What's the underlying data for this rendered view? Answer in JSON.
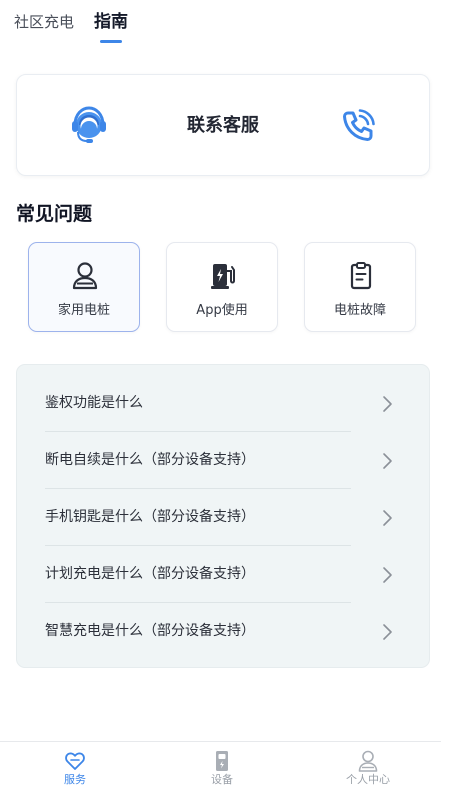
{
  "top_tabs": [
    {
      "label": "社区充电",
      "active": false
    },
    {
      "label": "指南",
      "active": true
    }
  ],
  "service": {
    "title": "联系客服",
    "left_icon": "headset-agent-icon",
    "right_icon": "phone-call-icon"
  },
  "faq": {
    "heading": "常见问题",
    "categories": [
      {
        "label": "家用电桩",
        "icon": "user-icon",
        "selected": true
      },
      {
        "label": "App使用",
        "icon": "charging-pile-icon",
        "selected": false
      },
      {
        "label": "电桩故障",
        "icon": "clipboard-icon",
        "selected": false
      }
    ],
    "items": [
      {
        "label": "鉴权功能是什么"
      },
      {
        "label": "断电自续是什么（部分设备支持）"
      },
      {
        "label": "手机钥匙是什么（部分设备支持）"
      },
      {
        "label": "计划充电是什么（部分设备支持）"
      },
      {
        "label": "智慧充电是什么（部分设备支持）"
      }
    ]
  },
  "bottom_nav": [
    {
      "label": "服务",
      "icon": "heart-icon",
      "active": true
    },
    {
      "label": "设备",
      "icon": "device-icon",
      "active": false
    },
    {
      "label": "个人中心",
      "icon": "person-icon",
      "active": false
    }
  ],
  "colors": {
    "accent": "#3d86e8",
    "faq_background": "#f0f5f6",
    "inactive_nav": "#9aa0a8"
  }
}
